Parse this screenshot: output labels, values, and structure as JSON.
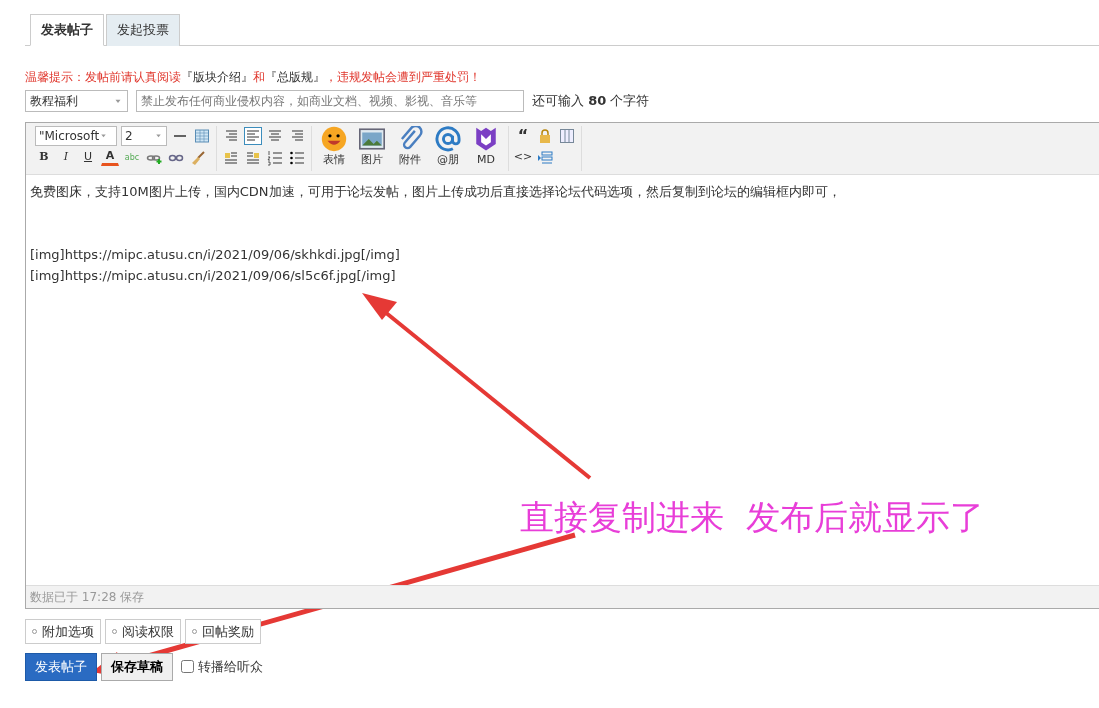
{
  "tabs": [
    {
      "label": "发表帖子",
      "selected": true
    },
    {
      "label": "发起投票",
      "selected": false
    }
  ],
  "notice": "温馨提示：发帖前请认真阅读**『版块介绍』**和**『总版规』**，违规发帖会遭到严重处罚！",
  "category_select": {
    "value": "教程福利"
  },
  "title_field": {
    "placeholder": "禁止发布任何商业侵权内容，如商业文档、视频、影视、音乐等"
  },
  "char_counter": "还可输入 **80** 个字符",
  "toolbar": {
    "font_select": "\"Microsoft",
    "size_select": "2",
    "row1": [
      {
        "kind": "rule"
      },
      {
        "kind": "table"
      }
    ],
    "row2": [
      {
        "kind": "bold",
        "glyph": "B"
      },
      {
        "kind": "italic",
        "glyph": "I"
      },
      {
        "kind": "underline",
        "glyph": "U"
      },
      {
        "kind": "color",
        "glyph": "A"
      },
      {
        "kind": "spell",
        "glyph": "abc"
      },
      {
        "kind": "link"
      },
      {
        "kind": "unlink"
      },
      {
        "kind": "eraser"
      }
    ],
    "align": [
      {
        "kind": "right-lines",
        "selected": false
      },
      {
        "kind": "left-lines",
        "selected": true
      },
      {
        "kind": "center-lines",
        "selected": false
      },
      {
        "kind": "right-lines",
        "selected": false
      },
      {
        "kind": "float-left",
        "selected": false
      },
      {
        "kind": "float-right",
        "selected": false
      },
      {
        "kind": "ordered-list",
        "selected": false
      },
      {
        "kind": "bullet-list",
        "selected": false
      }
    ],
    "big": [
      {
        "kind": "smiley",
        "label": "表情"
      },
      {
        "kind": "image",
        "label": "图片"
      },
      {
        "kind": "paperclip",
        "label": "附件"
      },
      {
        "kind": "at",
        "label": "@朋"
      },
      {
        "kind": "md",
        "label": "MD"
      }
    ],
    "extra": [
      {
        "kind": "quote",
        "glyph": "“"
      },
      {
        "kind": "lock"
      },
      {
        "kind": "columns"
      },
      {
        "kind": "code",
        "glyph": "<>"
      },
      {
        "kind": "indent"
      }
    ]
  },
  "editor_paragraphs": [
    {
      "lines": [
        "免费图床，支持10M图片上传，国内CDN加速，可用于论坛发帖，图片上传成功后直接选择论坛代码选项，然后复制到论坛的编辑框内即可，"
      ]
    },
    {
      "lines": [
        "[img]https://mipc.atusu.cn/i/2021/09/06/skhkdi.jpg[/img]",
        "[img]https://mipc.atusu.cn/i/2021/09/06/sl5c6f.jpg[/img]"
      ]
    }
  ],
  "status": "数据已于 17:28 保存",
  "options": [
    "附加选项",
    "阅读权限",
    "回帖奖励"
  ],
  "submit_button": "发表帖子",
  "draft_button": "保存草稿",
  "broadcast": {
    "label": "转播给听众",
    "checked": false
  },
  "annotation": "直接复制进来  发布后就显示了"
}
